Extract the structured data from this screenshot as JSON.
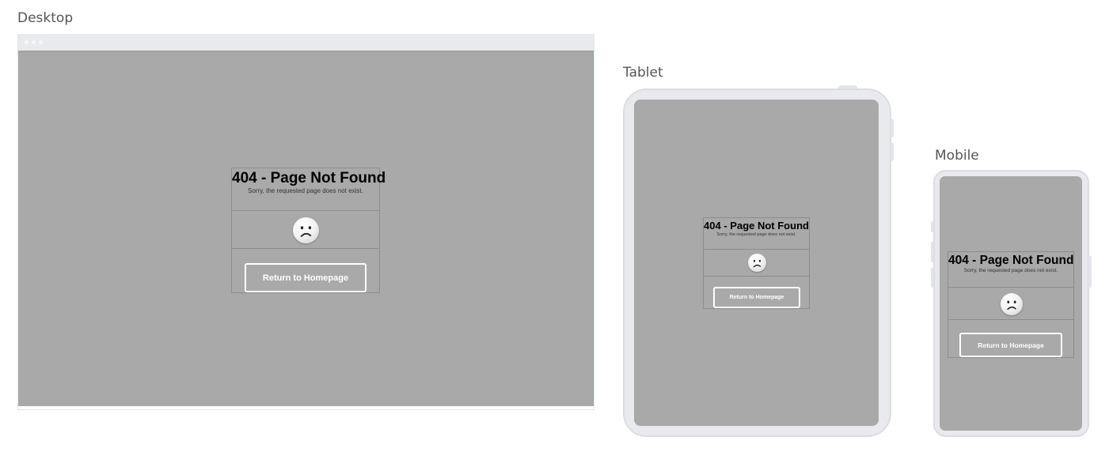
{
  "devices": {
    "desktop_label": "Desktop",
    "tablet_label": "Tablet",
    "mobile_label": "Mobile"
  },
  "page": {
    "title": "404 - Page Not Found",
    "subtitle": "Sorry, the requested page does not exist.",
    "face_icon": "sad-face-icon",
    "button_label": "Return to Homepage"
  },
  "colors": {
    "screen_background": "#a9a9a9",
    "device_frame": "#e9eaee",
    "button_border": "#ffffff",
    "card_border": "#8c8c8c"
  }
}
